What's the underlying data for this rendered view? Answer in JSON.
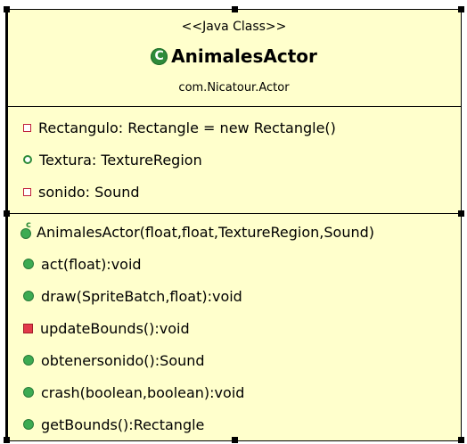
{
  "class": {
    "stereotype": "<<Java Class>>",
    "name": "AnimalesActor",
    "package": "com.Nicatour.Actor"
  },
  "fields": [
    {
      "text": "Rectangulo: Rectangle = new Rectangle()",
      "visibility": "private",
      "icon": "private-field-icon"
    },
    {
      "text": "Textura: TextureRegion",
      "visibility": "public",
      "icon": "public-field-icon"
    },
    {
      "text": "sonido: Sound",
      "visibility": "private",
      "icon": "private-field-icon"
    }
  ],
  "methods": [
    {
      "text": "AnimalesActor(float,float,TextureRegion,Sound)",
      "visibility": "public",
      "icon": "constructor-icon"
    },
    {
      "text": "act(float):void",
      "visibility": "public",
      "icon": "public-method-icon"
    },
    {
      "text": "draw(SpriteBatch,float):void",
      "visibility": "public",
      "icon": "public-method-icon"
    },
    {
      "text": "updateBounds():void",
      "visibility": "private",
      "icon": "private-method-icon"
    },
    {
      "text": "obtenersonido():Sound",
      "visibility": "public",
      "icon": "public-method-icon"
    },
    {
      "text": "crash(boolean,boolean):void",
      "visibility": "public",
      "icon": "public-method-icon"
    },
    {
      "text": "getBounds():Rectangle",
      "visibility": "public",
      "icon": "public-method-icon"
    }
  ],
  "colors": {
    "background": "#ffffcc",
    "public": "#3cab52",
    "private": "#e23a4a"
  }
}
